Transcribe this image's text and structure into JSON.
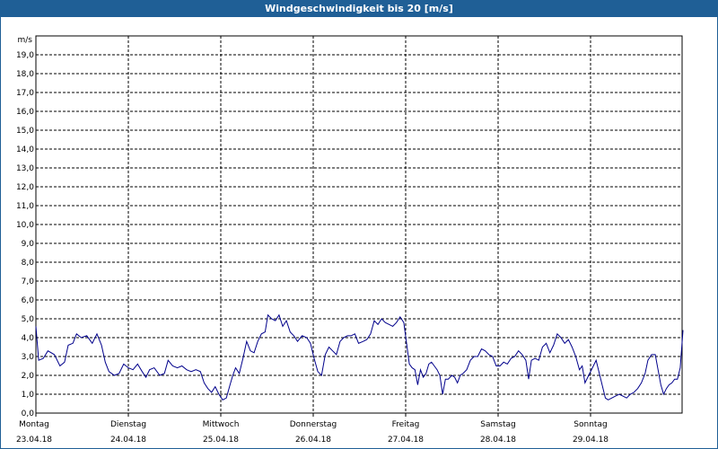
{
  "window": {
    "title": "Windgeschwindigkeit bis 20 [m/s]"
  },
  "chart_data": {
    "type": "line",
    "title": "Windgeschwindigkeit bis 20 [m/s]",
    "ylabel": "m/s",
    "xlabel": "",
    "ylim": [
      0,
      20
    ],
    "xlim": [
      0,
      7
    ],
    "grid": true,
    "line_color": "#00008b",
    "y_ticks": [
      "0,0",
      "1,0",
      "2,0",
      "3,0",
      "4,0",
      "5,0",
      "6,0",
      "7,0",
      "8,0",
      "9,0",
      "10,0",
      "11,0",
      "12,0",
      "13,0",
      "14,0",
      "15,0",
      "16,0",
      "17,0",
      "18,0",
      "19,0"
    ],
    "x_ticks": [
      {
        "day": "Montag",
        "date": "23.04.18"
      },
      {
        "day": "Dienstag",
        "date": "24.04.18"
      },
      {
        "day": "Mittwoch",
        "date": "25.04.18"
      },
      {
        "day": "Donnerstag",
        "date": "26.04.18"
      },
      {
        "day": "Freitag",
        "date": "27.04.18"
      },
      {
        "day": "Samstag",
        "date": "28.04.18"
      },
      {
        "day": "Sonntag",
        "date": "29.04.18"
      }
    ],
    "series": [
      {
        "x_unit": "days since Montag 23.04.18 00:00",
        "points": [
          [
            0.0,
            4.6
          ],
          [
            0.03,
            2.8
          ],
          [
            0.08,
            2.9
          ],
          [
            0.13,
            3.3
          ],
          [
            0.2,
            3.1
          ],
          [
            0.26,
            2.5
          ],
          [
            0.31,
            2.7
          ],
          [
            0.35,
            3.6
          ],
          [
            0.4,
            3.7
          ],
          [
            0.44,
            4.2
          ],
          [
            0.49,
            4.0
          ],
          [
            0.55,
            4.1
          ],
          [
            0.61,
            3.7
          ],
          [
            0.66,
            4.2
          ],
          [
            0.71,
            3.6
          ],
          [
            0.75,
            2.7
          ],
          [
            0.79,
            2.2
          ],
          [
            0.85,
            2.0
          ],
          [
            0.9,
            2.1
          ],
          [
            0.95,
            2.6
          ],
          [
            1.0,
            2.4
          ],
          [
            1.05,
            2.3
          ],
          [
            1.1,
            2.6
          ],
          [
            1.15,
            2.2
          ],
          [
            1.19,
            1.9
          ],
          [
            1.23,
            2.3
          ],
          [
            1.28,
            2.4
          ],
          [
            1.34,
            2.0
          ],
          [
            1.39,
            2.1
          ],
          [
            1.43,
            2.8
          ],
          [
            1.48,
            2.5
          ],
          [
            1.53,
            2.4
          ],
          [
            1.58,
            2.5
          ],
          [
            1.63,
            2.3
          ],
          [
            1.68,
            2.2
          ],
          [
            1.73,
            2.3
          ],
          [
            1.78,
            2.2
          ],
          [
            1.82,
            1.6
          ],
          [
            1.86,
            1.3
          ],
          [
            1.9,
            1.1
          ],
          [
            1.94,
            1.4
          ],
          [
            1.98,
            1.0
          ],
          [
            2.02,
            0.7
          ],
          [
            2.06,
            0.8
          ],
          [
            2.1,
            1.5
          ],
          [
            2.13,
            2.0
          ],
          [
            2.16,
            2.4
          ],
          [
            2.2,
            2.1
          ],
          [
            2.24,
            2.9
          ],
          [
            2.28,
            3.8
          ],
          [
            2.32,
            3.3
          ],
          [
            2.36,
            3.2
          ],
          [
            2.4,
            3.8
          ],
          [
            2.44,
            4.2
          ],
          [
            2.48,
            4.3
          ],
          [
            2.51,
            5.2
          ],
          [
            2.55,
            5.0
          ],
          [
            2.59,
            4.9
          ],
          [
            2.63,
            5.2
          ],
          [
            2.67,
            4.6
          ],
          [
            2.71,
            4.9
          ],
          [
            2.75,
            4.3
          ],
          [
            2.79,
            4.1
          ],
          [
            2.83,
            3.8
          ],
          [
            2.88,
            4.1
          ],
          [
            2.93,
            4.0
          ],
          [
            2.97,
            3.7
          ],
          [
            3.01,
            2.9
          ],
          [
            3.05,
            2.2
          ],
          [
            3.09,
            2.0
          ],
          [
            3.13,
            3.1
          ],
          [
            3.17,
            3.5
          ],
          [
            3.21,
            3.3
          ],
          [
            3.25,
            3.1
          ],
          [
            3.29,
            3.8
          ],
          [
            3.33,
            4.0
          ],
          [
            3.37,
            4.1
          ],
          [
            3.41,
            4.1
          ],
          [
            3.45,
            4.2
          ],
          [
            3.49,
            3.7
          ],
          [
            3.54,
            3.8
          ],
          [
            3.58,
            3.9
          ],
          [
            3.62,
            4.2
          ],
          [
            3.66,
            4.9
          ],
          [
            3.7,
            4.7
          ],
          [
            3.74,
            5.0
          ],
          [
            3.78,
            4.8
          ],
          [
            3.82,
            4.7
          ],
          [
            3.86,
            4.6
          ],
          [
            3.9,
            4.8
          ],
          [
            3.94,
            5.1
          ],
          [
            3.98,
            4.8
          ],
          [
            4.01,
            3.7
          ],
          [
            4.04,
            2.6
          ],
          [
            4.07,
            2.4
          ],
          [
            4.1,
            2.3
          ],
          [
            4.13,
            1.5
          ],
          [
            4.16,
            2.3
          ],
          [
            4.19,
            1.9
          ],
          [
            4.22,
            2.1
          ],
          [
            4.25,
            2.6
          ],
          [
            4.28,
            2.7
          ],
          [
            4.31,
            2.5
          ],
          [
            4.34,
            2.3
          ],
          [
            4.37,
            2.0
          ],
          [
            4.4,
            1.0
          ],
          [
            4.43,
            1.8
          ],
          [
            4.46,
            1.8
          ],
          [
            4.5,
            2.0
          ],
          [
            4.53,
            1.9
          ],
          [
            4.56,
            1.6
          ],
          [
            4.59,
            2.0
          ],
          [
            4.62,
            2.1
          ],
          [
            4.66,
            2.3
          ],
          [
            4.7,
            2.8
          ],
          [
            4.74,
            3.0
          ],
          [
            4.78,
            3.0
          ],
          [
            4.82,
            3.4
          ],
          [
            4.86,
            3.3
          ],
          [
            4.9,
            3.1
          ],
          [
            4.94,
            3.0
          ],
          [
            4.98,
            2.5
          ],
          [
            5.02,
            2.5
          ],
          [
            5.06,
            2.7
          ],
          [
            5.1,
            2.6
          ],
          [
            5.14,
            2.9
          ],
          [
            5.18,
            3.0
          ],
          [
            5.22,
            3.3
          ],
          [
            5.26,
            3.1
          ],
          [
            5.3,
            2.8
          ],
          [
            5.33,
            1.8
          ],
          [
            5.36,
            2.8
          ],
          [
            5.4,
            2.9
          ],
          [
            5.44,
            2.8
          ],
          [
            5.48,
            3.5
          ],
          [
            5.52,
            3.7
          ],
          [
            5.56,
            3.2
          ],
          [
            5.6,
            3.6
          ],
          [
            5.64,
            4.2
          ],
          [
            5.68,
            4.0
          ],
          [
            5.72,
            3.7
          ],
          [
            5.76,
            3.9
          ],
          [
            5.8,
            3.5
          ],
          [
            5.84,
            3.0
          ],
          [
            5.88,
            2.3
          ],
          [
            5.91,
            2.5
          ],
          [
            5.94,
            1.6
          ],
          [
            5.98,
            2.0
          ],
          [
            6.02,
            2.4
          ],
          [
            6.06,
            2.8
          ],
          [
            6.1,
            2.0
          ],
          [
            6.13,
            1.4
          ],
          [
            6.16,
            0.8
          ],
          [
            6.19,
            0.7
          ],
          [
            6.23,
            0.8
          ],
          [
            6.27,
            0.9
          ],
          [
            6.31,
            1.0
          ],
          [
            6.35,
            0.9
          ],
          [
            6.39,
            0.8
          ],
          [
            6.43,
            1.0
          ],
          [
            6.47,
            1.1
          ],
          [
            6.51,
            1.3
          ],
          [
            6.55,
            1.6
          ],
          [
            6.59,
            2.1
          ],
          [
            6.62,
            2.8
          ],
          [
            6.66,
            3.1
          ],
          [
            6.7,
            3.1
          ],
          [
            6.73,
            2.3
          ],
          [
            6.76,
            1.5
          ],
          [
            6.79,
            1.0
          ],
          [
            6.82,
            1.3
          ],
          [
            6.85,
            1.5
          ],
          [
            6.88,
            1.6
          ],
          [
            6.91,
            1.8
          ],
          [
            6.94,
            1.8
          ],
          [
            6.97,
            2.4
          ],
          [
            7.0,
            4.4
          ]
        ]
      }
    ]
  }
}
